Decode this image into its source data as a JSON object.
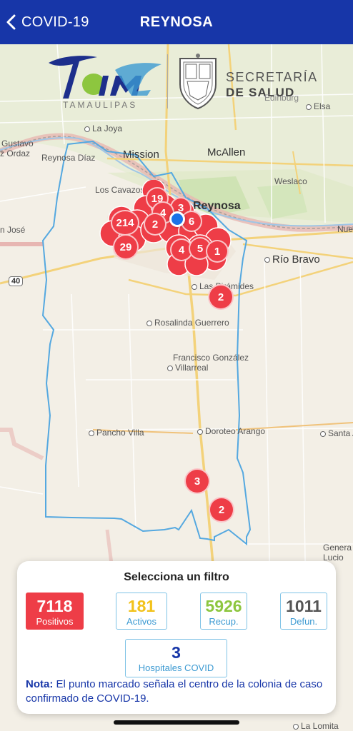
{
  "nav": {
    "back_label": "COVID-19",
    "title": "REYNOSA"
  },
  "logo": {
    "brand": "Tam",
    "brand_sub": "TAMAULIPAS",
    "line1": "SECRETARÍA",
    "line2": "DE SALUD"
  },
  "map": {
    "places": {
      "edinburg": "Edinburg",
      "elsa": "Elsa",
      "la_joya": "La Joya",
      "gustavo": "Gustavo",
      "diaz_ordaz": "z Ordaz",
      "reynosa_diaz": "Reynosa Díaz",
      "mission": "Mission",
      "mcallen": "McAllen",
      "weslaco": "Weslaco",
      "los_cavazos": "Los Cavazos",
      "reynosa": "Reynosa",
      "san_jose": "n José",
      "nue": "Nue",
      "rio_bravo": "Río Bravo",
      "highway": "40",
      "las_piramides": "Las Pirámides",
      "rosalinda": "Rosalinda Guerrero",
      "francisco1": "Francisco González",
      "francisco2": "Villarreal",
      "pancho_villa": "Pancho Villa",
      "doroteo": "Doroteo Arango",
      "santa": "Santa A",
      "genera1": "Genera",
      "genera2": "Lucio",
      "la_lomita": "La Lomita"
    },
    "clusters": [
      "19",
      "3",
      "4",
      "214",
      "2",
      "6",
      "29",
      "4",
      "5",
      "1",
      "2",
      "3",
      "2"
    ]
  },
  "filter": {
    "title": "Selecciona un filtro",
    "positivos": {
      "value": "7118",
      "label": "Positivos"
    },
    "activos": {
      "value": "181",
      "label": "Activos"
    },
    "recuperados": {
      "value": "5926",
      "label": "Recup."
    },
    "defunciones": {
      "value": "1011",
      "label": "Defun."
    },
    "hospitales": {
      "value": "3",
      "label": "Hospitales COVID"
    },
    "note_label": "Nota:",
    "note_text": " El punto marcado señala el centro de la colonia de caso confirmado de COVID-19."
  },
  "colors": {
    "nav_bg": "#1736a8",
    "positivos": "#ee3d47",
    "activos": "#f2c21b",
    "recuperados": "#8dc63f",
    "defunciones": "#555555",
    "hospitales": "#1736a8"
  }
}
